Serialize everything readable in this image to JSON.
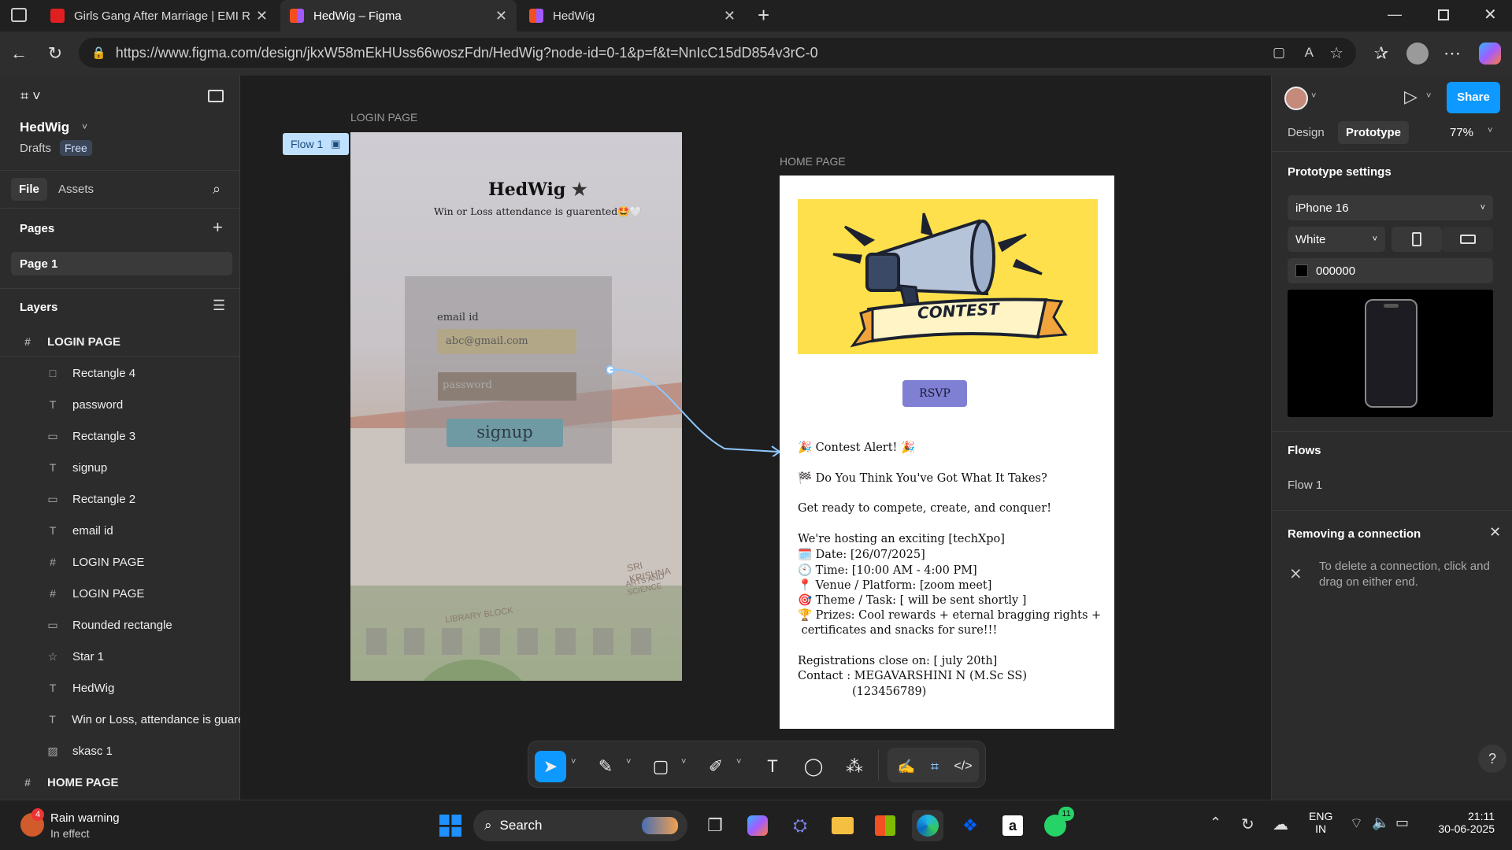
{
  "browser": {
    "tabs": [
      {
        "title": "Girls Gang After Marriage | EMI R"
      },
      {
        "title": "HedWig – Figma"
      },
      {
        "title": "HedWig"
      }
    ],
    "url": "https://www.figma.com/design/jkxW58mEkHUss66woszFdn/HedWig?node-id=0-1&p=f&t=NnIcC15dD854v3rC-0"
  },
  "left_panel": {
    "file_name": "HedWig",
    "drafts": "Drafts",
    "plan_badge": "Free",
    "tabs": [
      "File",
      "Assets"
    ],
    "pages_heading": "Pages",
    "page_selected": "Page 1",
    "layers_heading": "Layers",
    "layers": [
      {
        "label": "LOGIN PAGE",
        "icon": "#"
      },
      {
        "label": "Rectangle 4",
        "icon": "□"
      },
      {
        "label": "password",
        "icon": "T"
      },
      {
        "label": "Rectangle 3",
        "icon": "▭"
      },
      {
        "label": "signup",
        "icon": "T"
      },
      {
        "label": "Rectangle 2",
        "icon": "▭"
      },
      {
        "label": "email id",
        "icon": "T"
      },
      {
        "label": "LOGIN PAGE",
        "icon": "#"
      },
      {
        "label": "LOGIN PAGE",
        "icon": "#"
      },
      {
        "label": "Rounded rectangle",
        "icon": "▭"
      },
      {
        "label": "Star 1",
        "icon": "☆"
      },
      {
        "label": "HedWig",
        "icon": "T"
      },
      {
        "label": "Win or Loss, attendance is guarer",
        "icon": "T"
      },
      {
        "label": "skasc 1",
        "icon": "▨"
      },
      {
        "label": "HOME PAGE",
        "icon": "#"
      }
    ]
  },
  "canvas": {
    "flow_label": "Flow 1",
    "login_label": "LOGIN PAGE",
    "home_label": "HOME PAGE",
    "login": {
      "title": "HedWig",
      "tagline": "Win or Loss attendance is guarented🤩🤍",
      "email_label": "email id",
      "email_value": "abc@gmail.com",
      "password_value": "password",
      "signup": "signup",
      "building_text_1": "SRI KRISHNA",
      "building_text_2": "ARTS AND SCIENCE",
      "building_text_3": "LIBRARY BLOCK"
    },
    "home": {
      "banner_text": "CONTEST",
      "rsvp": "RSVP",
      "lines": [
        "🎉 Contest Alert! 🎉",
        "🏁 Do You Think You've Got What It Takes?",
        "Get ready to compete, create, and conquer!",
        "We're hosting an exciting [techXpo]",
        "🗓️ Date: [26/07/2025]",
        "🕙 Time: [10:00 AM - 4:00 PM]",
        "📍 Venue / Platform: [zoom meet]",
        "🎯 Theme / Task: [ will be sent shortly ]",
        "🏆 Prizes: Cool rewards + eternal bragging rights +",
        " certificates and snacks for sure!!!",
        "Registrations close on: [ july 20th]",
        "Contact : MEGAVARSHINI N (M.Sc SS)",
        "(123456789)"
      ]
    }
  },
  "right_panel": {
    "share": "Share",
    "tabs": [
      "Design",
      "Prototype"
    ],
    "zoom": "77%",
    "settings_heading": "Prototype settings",
    "device": "iPhone 16",
    "color_model": "White",
    "bg_hex": "000000",
    "flows_heading": "Flows",
    "flow_item": "Flow 1",
    "removing_heading": "Removing a connection",
    "removing_text": "To delete a connection, click and drag on either end."
  },
  "taskbar": {
    "weather_title": "Rain warning",
    "weather_sub": "In effect",
    "weather_badge": "4",
    "search": "Search",
    "whatsapp_badge": "11",
    "lang_1": "ENG",
    "lang_2": "IN",
    "time": "21:11",
    "date": "30-06-2025"
  }
}
